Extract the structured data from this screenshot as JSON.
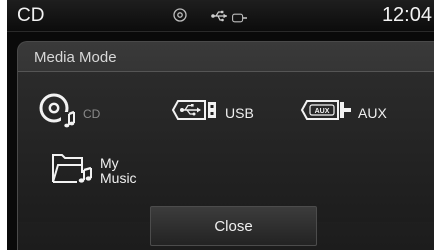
{
  "status_bar": {
    "source": "CD",
    "clock": "12:04",
    "icons": [
      "disc-icon",
      "usb-icon",
      "aux-icon"
    ]
  },
  "dialog": {
    "title": "Media Mode",
    "modes": [
      {
        "label": "CD",
        "icon": "cd-music-icon",
        "state": "active"
      },
      {
        "label": "USB",
        "icon": "usb-port-icon"
      },
      {
        "label": "AUX",
        "icon": "aux-port-icon"
      },
      {
        "label_line1": "My",
        "label_line2": "Music",
        "icon": "music-folder-icon"
      }
    ],
    "close_label": "Close"
  },
  "colors": {
    "background": "#0a0a0a",
    "text": "#f0f0f0",
    "dim_text": "#8a8a8a"
  }
}
